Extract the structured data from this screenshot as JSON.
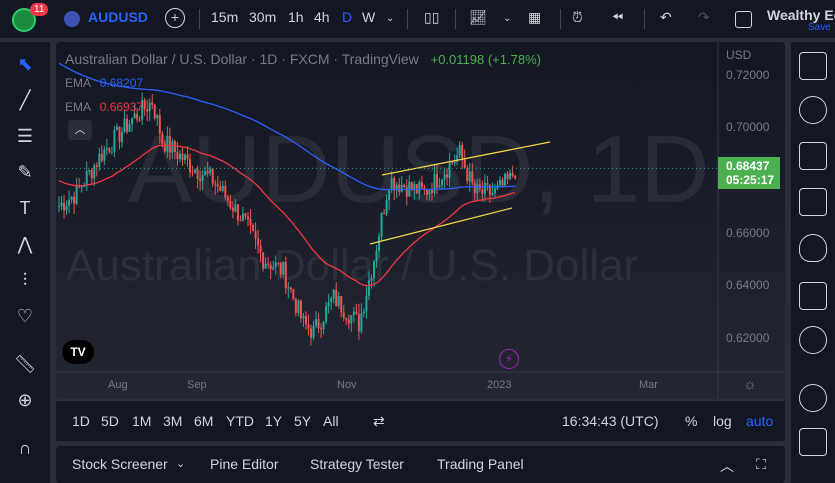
{
  "toolbar": {
    "badge": "11",
    "symbol": "AUDUSD",
    "intervals": [
      "15m",
      "30m",
      "1h",
      "4h",
      "D",
      "W"
    ],
    "account": "Wealthy Ed",
    "save": "Save"
  },
  "chart": {
    "title": "Australian Dollar / U.S. Dollar · 1D · FXCM · TradingView",
    "change": "+0.01198 (+1.78%)",
    "ema1_label": "EMA",
    "ema1_value": "0.68207",
    "ema2_label": "EMA",
    "ema2_value": "0.66937",
    "watermark_symbol": "AUDUSD, 1D",
    "watermark_name": "Australian Dollar / U.S. Dollar",
    "currency": "USD",
    "last_price": "0.68437",
    "countdown": "05:25:17",
    "price_ticks": [
      "0.72000",
      "0.70000",
      "0.66000",
      "0.64000",
      "0.62000"
    ],
    "time_ticks": [
      "Aug",
      "Sep",
      "Nov",
      "2023",
      "Mar"
    ],
    "colors": {
      "up": "#26a69a",
      "down": "#ef5350",
      "ema_fast": "#2962ff",
      "ema_slow": "#f23645",
      "trend": "#f0d24a",
      "price_label": "#4caf50"
    },
    "price_path": [
      [
        0,
        0.67
      ],
      [
        7,
        0.675
      ],
      [
        17,
        0.69
      ],
      [
        29,
        0.703
      ],
      [
        37,
        0.71
      ],
      [
        41,
        0.695
      ],
      [
        53,
        0.685
      ],
      [
        61,
        0.68
      ],
      [
        73,
        0.665
      ],
      [
        81,
        0.65
      ],
      [
        89,
        0.645
      ],
      [
        97,
        0.625
      ],
      [
        101,
        0.622
      ],
      [
        109,
        0.635
      ],
      [
        119,
        0.625
      ],
      [
        125,
        0.65
      ],
      [
        131,
        0.68
      ],
      [
        145,
        0.675
      ],
      [
        159,
        0.69
      ],
      [
        165,
        0.675
      ],
      [
        173,
        0.675
      ],
      [
        179,
        0.68
      ],
      [
        181,
        0.684
      ]
    ]
  },
  "timebar": {
    "ranges": [
      "1D",
      "5D",
      "1M",
      "3M",
      "6M",
      "YTD",
      "1Y",
      "5Y",
      "All"
    ],
    "clock": "16:34:43 (UTC)",
    "percent": "%",
    "log": "log",
    "auto": "auto"
  },
  "bottom": {
    "tabs": [
      "Stock Screener",
      "Pine Editor",
      "Strategy Tester",
      "Trading Panel"
    ]
  }
}
